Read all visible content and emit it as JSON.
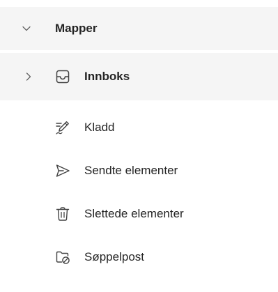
{
  "folders_pane": {
    "header": {
      "label": "Mapper",
      "icon": "chevron-down-icon"
    },
    "items": [
      {
        "label": "Innboks",
        "icon": "inbox-icon",
        "expand_icon": "chevron-right-icon",
        "selected": true
      },
      {
        "label": "Kladd",
        "icon": "drafts-pencil-icon"
      },
      {
        "label": "Sendte elementer",
        "icon": "send-icon"
      },
      {
        "label": "Slettede elementer",
        "icon": "trash-icon"
      },
      {
        "label": "Søppelpost",
        "icon": "junk-folder-icon"
      }
    ]
  },
  "colors": {
    "row_highlight": "#f5f5f5",
    "text": "#242424",
    "icon": "#424242"
  }
}
